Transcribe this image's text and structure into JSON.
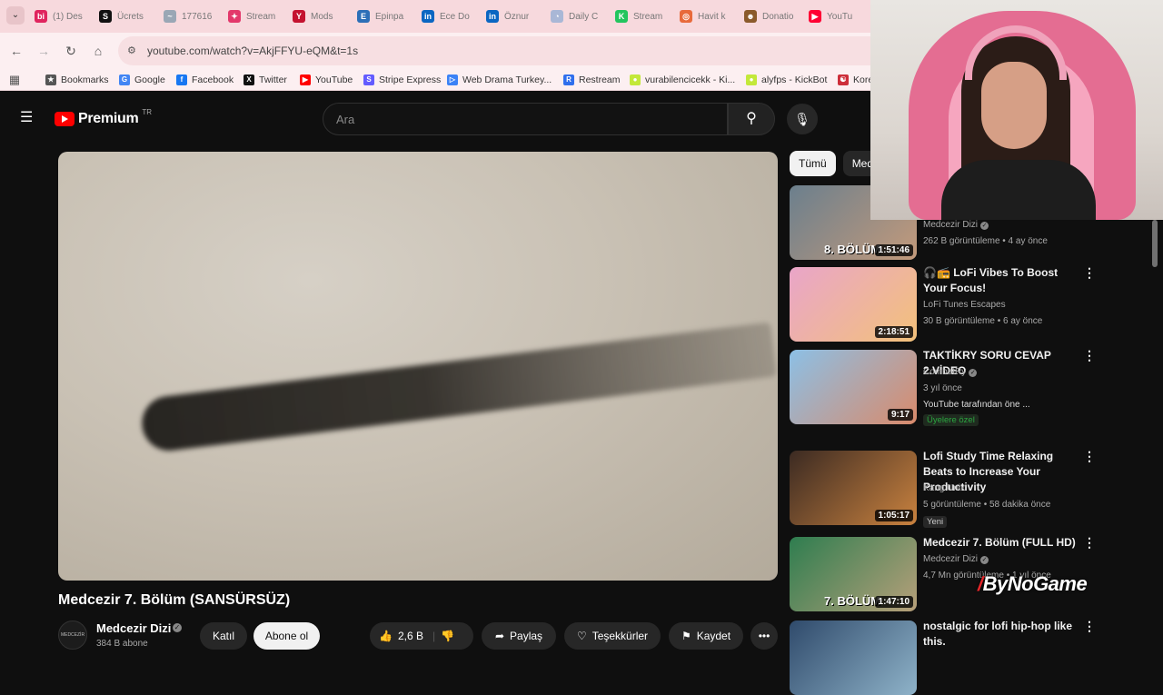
{
  "browser": {
    "tabs": [
      {
        "label": "(1) Des",
        "icon": "bi",
        "color": "#e0245e"
      },
      {
        "label": "Ücrets",
        "icon": "S",
        "color": "#111111"
      },
      {
        "label": "177616",
        "icon": "~",
        "color": "#9aa7b5"
      },
      {
        "label": "Stream",
        "icon": "✦",
        "color": "#e3386b"
      },
      {
        "label": "Mods",
        "icon": "Y",
        "color": "#c4122f"
      },
      {
        "label": "Epinpa",
        "icon": "E",
        "color": "#2c6fb7"
      },
      {
        "label": "Ece Do",
        "icon": "in",
        "color": "#0a66c2"
      },
      {
        "label": "Öznur",
        "icon": "in",
        "color": "#0a66c2"
      },
      {
        "label": "Daily C",
        "icon": "◔",
        "color": "#a9b7d6"
      },
      {
        "label": "Stream",
        "icon": "K",
        "color": "#22c55e"
      },
      {
        "label": "Havit k",
        "icon": "◎",
        "color": "#e86a3b"
      },
      {
        "label": "Donatio",
        "icon": "☻",
        "color": "#8b5a2b"
      },
      {
        "label": "YouTu",
        "icon": "▶",
        "color": "#ff0033"
      }
    ],
    "url": "youtube.com/watch?v=AkjFFYU-eQM&t=1s",
    "bookmarks": [
      {
        "label": "Bookmarks",
        "icon": "★",
        "color": "#555555"
      },
      {
        "label": "Google",
        "icon": "G",
        "color": "#4285f4"
      },
      {
        "label": "Facebook",
        "icon": "f",
        "color": "#1877f2"
      },
      {
        "label": "Twitter",
        "icon": "X",
        "color": "#111111"
      },
      {
        "label": "YouTube",
        "icon": "▶",
        "color": "#ff0000"
      },
      {
        "label": "Stripe Express",
        "icon": "S",
        "color": "#635bff"
      },
      {
        "label": "Web Drama Turkey...",
        "icon": "▷",
        "color": "#3b82f6"
      },
      {
        "label": "Restream",
        "icon": "R",
        "color": "#2f6fed"
      },
      {
        "label": "vurabilencicekk - Ki...",
        "icon": "●",
        "color": "#c3e83a"
      },
      {
        "label": "alyfps - KickBot",
        "icon": "●",
        "color": "#c3e83a"
      },
      {
        "label": "Kore",
        "icon": "☯",
        "color": "#cd2e3a"
      }
    ]
  },
  "header": {
    "logo": "Premium",
    "country": "TR",
    "search_placeholder": "Ara"
  },
  "video": {
    "title": "Medcezir 7. Bölüm (SANSÜRSÜZ)",
    "channel": "Medcezir Dizi",
    "avatar_text": "MEDCEZİR",
    "subscribers": "384 B abone",
    "join_label": "Katıl",
    "subscribe_label": "Abone ol",
    "likes": "2,6 B",
    "share_label": "Paylaş",
    "thanks_label": "Teşekkürler",
    "save_label": "Kaydet"
  },
  "chips": [
    "Tümü",
    "Med"
  ],
  "related": [
    {
      "thumb_text": "8. BÖLÜM",
      "duration": "1:51:46",
      "title": "",
      "channel": "Medcezir Dizi",
      "verified": true,
      "meta": "262 B görüntüleme • 4 ay önce",
      "colors": [
        "#6b7f8d",
        "#c39a7b"
      ]
    },
    {
      "thumb_text": "",
      "duration": "2:18:51",
      "title": "🎧📻 LoFi Vibes To Boost Your Focus!",
      "channel": "LoFi Tunes Escapes",
      "verified": false,
      "meta": "30 B görüntüleme • 6 ay önce",
      "colors": [
        "#e9a5c9",
        "#f3c17a"
      ]
    },
    {
      "thumb_text": "",
      "duration": "9:17",
      "title": "TAKTİKRY SORU CEVAP 2.VİDEO",
      "channel": "CombatRy",
      "verified": true,
      "meta": "3 yıl önce",
      "extra": "YouTube tarafından öne ...",
      "badge": "Üyelere özel",
      "colors": [
        "#8cc0e6",
        "#d98a6b"
      ]
    },
    {
      "thumb_text": "",
      "duration": "1:05:17",
      "title": "Lofi Study Time Relaxing Beats to Increase Your Productivity",
      "channel": "Kang Unix",
      "verified": false,
      "meta": "5 görüntüleme • 58 dakika önce",
      "badge": "Yeni",
      "colors": [
        "#3b2a22",
        "#c9823f"
      ]
    },
    {
      "thumb_text": "7. BÖLÜM",
      "duration": "1:47:10",
      "title": "Medcezir 7. Bölüm (FULL HD)",
      "channel": "Medcezir Dizi",
      "verified": true,
      "meta": "4,7 Mn görüntüleme • 1 yıl önce",
      "colors": [
        "#2e7d4f",
        "#b7a07a"
      ]
    },
    {
      "thumb_text": "",
      "duration": "",
      "title": "nostalgic for lofi hip-hop like this.",
      "channel": "",
      "verified": false,
      "meta": "",
      "colors": [
        "#2f4a6b",
        "#8fb3c9"
      ]
    }
  ],
  "watermark": {
    "brand": "ByNoGame",
    "mark": "/"
  }
}
